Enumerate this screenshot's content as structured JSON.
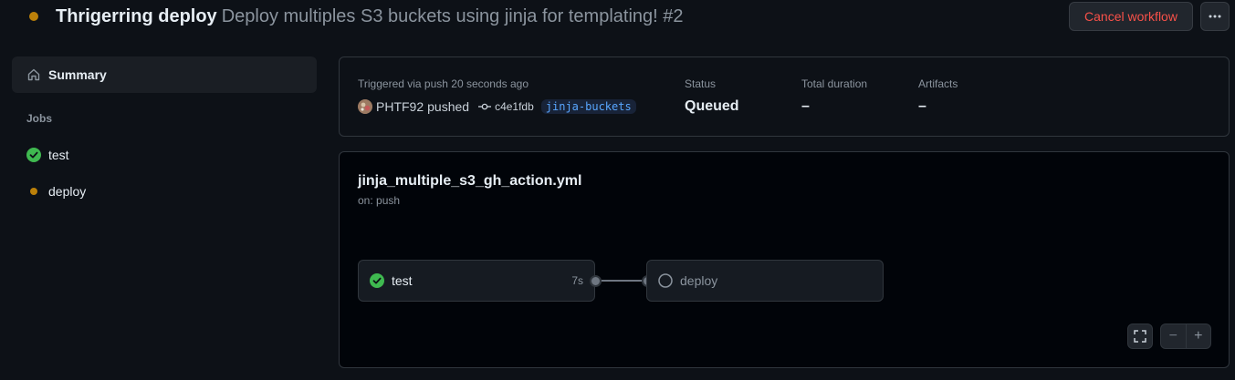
{
  "header": {
    "run_name": "Thrigerring deploy",
    "run_description": "Deploy multiples S3 buckets using jinja for templating! #2",
    "cancel_label": "Cancel workflow",
    "more_label": "···"
  },
  "sidebar": {
    "summary_label": "Summary",
    "jobs_heading": "Jobs",
    "jobs": [
      {
        "name": "test",
        "status": "success"
      },
      {
        "name": "deploy",
        "status": "queued"
      }
    ]
  },
  "info": {
    "triggered_text": "Triggered via push 20 seconds ago",
    "actor": "PHTF92",
    "action": "pushed",
    "commit_sha": "c4e1fdb",
    "branch": "jinja-buckets",
    "status_label": "Status",
    "status_value": "Queued",
    "duration_label": "Total duration",
    "duration_value": "–",
    "artifacts_label": "Artifacts",
    "artifacts_value": "–"
  },
  "graph": {
    "workflow_file": "jinja_multiple_s3_gh_action.yml",
    "trigger": "on: push",
    "nodes": [
      {
        "name": "test",
        "duration": "7s",
        "status": "success"
      },
      {
        "name": "deploy",
        "duration": "",
        "status": "queued"
      }
    ],
    "controls": {
      "fullscreen": "fullscreen-icon",
      "zoom_out": "−",
      "zoom_in": "+"
    }
  },
  "colors": {
    "background": "#0d1117",
    "queued": "#bb8009",
    "success": "#3fb950",
    "danger": "#f85149",
    "link": "#58a6ff"
  }
}
